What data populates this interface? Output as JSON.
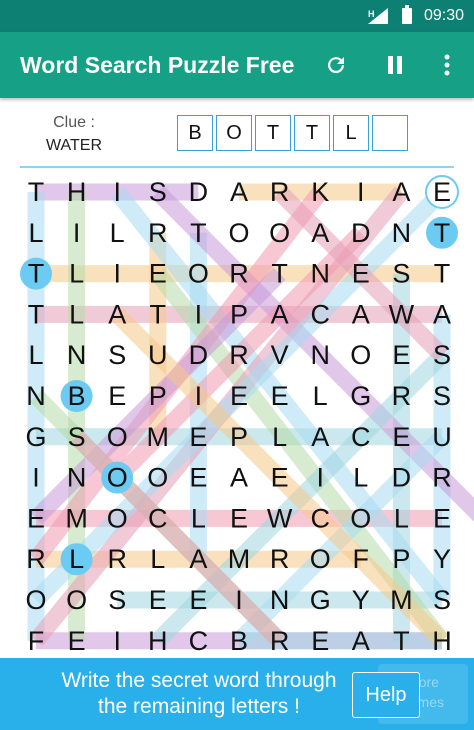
{
  "status": {
    "time": "09:30",
    "network": "H"
  },
  "app": {
    "title": "Word Search Puzzle Free"
  },
  "clue": {
    "label": "Clue :",
    "word": "WATER"
  },
  "answer_boxes": [
    "B",
    "O",
    "T",
    "T",
    "L",
    ""
  ],
  "grid": {
    "rows": [
      "THISDARKIAE",
      "LILRTOOADNT",
      "TLIEORTNEST",
      "TLATIPACAWA",
      "LNSUDRVNOES",
      "NBEPIEELGRS",
      "GSOMEPLACEU",
      "INOOEAEILDR",
      "EMOCLEWCOLE",
      "RLRLAMROFPY",
      "OOSEEINGYMS",
      "FEIHCBREATH"
    ],
    "circled": [
      [
        0,
        10
      ],
      [
        1,
        10
      ],
      [
        2,
        0
      ],
      [
        5,
        1
      ],
      [
        7,
        2
      ],
      [
        9,
        1
      ]
    ],
    "circle_fill_color": "#6ccbf2",
    "found_lines": [
      {
        "from": [
          0,
          0
        ],
        "to": [
          0,
          4
        ],
        "color": "#c99ad9"
      },
      {
        "from": [
          0,
          5
        ],
        "to": [
          0,
          9
        ],
        "color": "#f7c98a"
      },
      {
        "from": [
          0,
          0
        ],
        "to": [
          11,
          0
        ],
        "color": "#a8dcf2"
      },
      {
        "from": [
          2,
          0
        ],
        "to": [
          2,
          10
        ],
        "color": "#f7c98a"
      },
      {
        "from": [
          3,
          0
        ],
        "to": [
          3,
          10
        ],
        "color": "#e7a0b8"
      },
      {
        "from": [
          6,
          0
        ],
        "to": [
          6,
          10
        ],
        "color": "#9fd6e0"
      },
      {
        "from": [
          8,
          0
        ],
        "to": [
          8,
          10
        ],
        "color": "#f19ab2"
      },
      {
        "from": [
          9,
          0
        ],
        "to": [
          9,
          8
        ],
        "color": "#f7c98a"
      },
      {
        "from": [
          10,
          2
        ],
        "to": [
          10,
          10
        ],
        "color": "#9fd6e0"
      },
      {
        "from": [
          11,
          0
        ],
        "to": [
          11,
          10
        ],
        "color": "#c99ad9"
      },
      {
        "from": [
          11,
          5
        ],
        "to": [
          11,
          10
        ],
        "color": "#9fd6e0"
      },
      {
        "from": [
          0,
          1
        ],
        "to": [
          11,
          1
        ],
        "color": "#b6dca8"
      },
      {
        "from": [
          1,
          4
        ],
        "to": [
          9,
          4
        ],
        "color": "#a8dcf2"
      },
      {
        "from": [
          2,
          9
        ],
        "to": [
          11,
          9
        ],
        "color": "#9fd6e0"
      },
      {
        "from": [
          3,
          10
        ],
        "to": [
          10,
          10
        ],
        "color": "#a8dcf2"
      },
      {
        "from": [
          1,
          3
        ],
        "to": [
          6,
          3
        ],
        "color": "#f7c98a"
      },
      {
        "from": [
          0,
          3
        ],
        "to": [
          8,
          11
        ],
        "color": "#c99ad9"
      },
      {
        "from": [
          0,
          2
        ],
        "to": [
          10,
          10
        ],
        "color": "#a8dcf2"
      },
      {
        "from": [
          2,
          3
        ],
        "to": [
          11,
          10
        ],
        "color": "#b6dca8"
      },
      {
        "from": [
          0,
          9
        ],
        "to": [
          11,
          0
        ],
        "color": "#e7a0b8"
      },
      {
        "from": [
          0,
          7
        ],
        "to": [
          9,
          0
        ],
        "color": "#f19ab2"
      },
      {
        "from": [
          0,
          10
        ],
        "to": [
          10,
          0
        ],
        "color": "#a8dcf2"
      },
      {
        "from": [
          1,
          8
        ],
        "to": [
          7,
          2
        ],
        "color": "#f19ab2"
      },
      {
        "from": [
          2,
          6
        ],
        "to": [
          8,
          0
        ],
        "color": "#c99ad9"
      },
      {
        "from": [
          4,
          10
        ],
        "to": [
          11,
          3
        ],
        "color": "#9fd6e0"
      },
      {
        "from": [
          6,
          10
        ],
        "to": [
          11,
          5
        ],
        "color": "#a8dcf2"
      },
      {
        "from": [
          0,
          6
        ],
        "to": [
          4,
          10
        ],
        "color": "#e7a0b8"
      },
      {
        "from": [
          3,
          2
        ],
        "to": [
          11,
          10
        ],
        "color": "#f7c98a"
      },
      {
        "from": [
          5,
          0
        ],
        "to": [
          11,
          6
        ],
        "color": "#b6dca8"
      },
      {
        "from": [
          6,
          1
        ],
        "to": [
          11,
          6
        ],
        "color": "#e7a0b8"
      }
    ]
  },
  "footer": {
    "message_line1": "Write the secret word through",
    "message_line2": "the remaining letters !",
    "help_label": "Help",
    "more_games_line1": "More",
    "more_games_line2": "games"
  }
}
